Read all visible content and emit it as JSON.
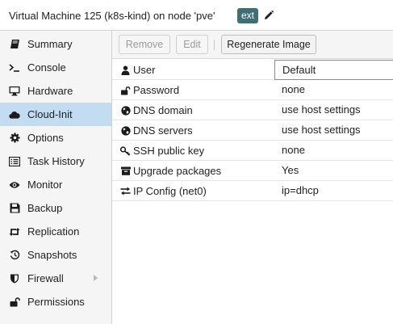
{
  "header": {
    "title": "Virtual Machine 125 (k8s-kind) on node 'pve'",
    "tag": "ext",
    "edit_icon": "pencil-icon"
  },
  "sidebar": {
    "items": [
      {
        "label": "Summary",
        "icon": "book-icon"
      },
      {
        "label": "Console",
        "icon": "terminal-icon"
      },
      {
        "label": "Hardware",
        "icon": "desktop-icon"
      },
      {
        "label": "Cloud-Init",
        "icon": "cloud-icon",
        "active": true
      },
      {
        "label": "Options",
        "icon": "gear-icon"
      },
      {
        "label": "Task History",
        "icon": "list-icon"
      },
      {
        "label": "Monitor",
        "icon": "eye-icon"
      },
      {
        "label": "Backup",
        "icon": "floppy-icon"
      },
      {
        "label": "Replication",
        "icon": "retweet-icon"
      },
      {
        "label": "Snapshots",
        "icon": "history-icon"
      },
      {
        "label": "Firewall",
        "icon": "shield-icon",
        "has_submenu": true
      },
      {
        "label": "Permissions",
        "icon": "unlock-icon"
      }
    ]
  },
  "toolbar": {
    "remove_label": "Remove",
    "edit_label": "Edit",
    "regenerate_label": "Regenerate Image"
  },
  "grid": {
    "rows": [
      {
        "key": "User",
        "value": "Default",
        "icon": "user-icon"
      },
      {
        "key": "Password",
        "value": "none",
        "icon": "unlock-icon"
      },
      {
        "key": "DNS domain",
        "value": "use host settings",
        "icon": "globe-icon"
      },
      {
        "key": "DNS servers",
        "value": "use host settings",
        "icon": "globe-icon"
      },
      {
        "key": "SSH public key",
        "value": "none",
        "icon": "key-icon"
      },
      {
        "key": "Upgrade packages",
        "value": "Yes",
        "icon": "archive-icon"
      },
      {
        "key": "IP Config (net0)",
        "value": "ip=dhcp",
        "icon": "exchange-icon"
      }
    ]
  },
  "colors": {
    "active_nav": "#c2ddf2",
    "tag_bg": "#3f6f73",
    "sidebar_bg": "#f5f5f5"
  }
}
